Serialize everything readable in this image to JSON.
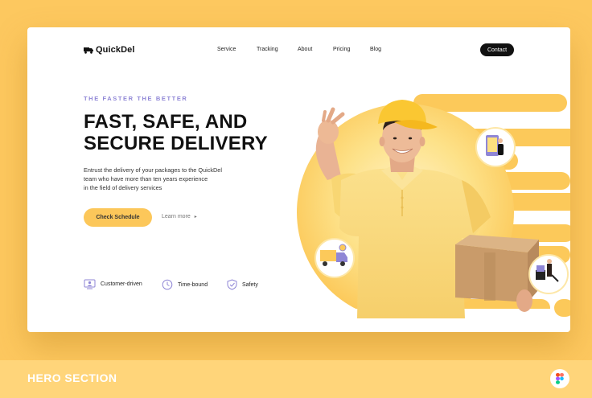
{
  "brand": {
    "name": "QuickDel"
  },
  "nav": {
    "items": [
      {
        "label": "Service"
      },
      {
        "label": "Tracking"
      },
      {
        "label": "About"
      },
      {
        "label": "Pricing"
      },
      {
        "label": "Blog"
      }
    ],
    "contact_label": "Contact"
  },
  "hero": {
    "eyebrow": "THE FASTER THE BETTER",
    "headline_line1": "FAST, SAFE, AND",
    "headline_line2": "SECURE DELIVERY",
    "desc_line1": "Entrust the delivery of your packages to the QuickDel",
    "desc_line2": "team who have more than ten years experience",
    "desc_line3": "in the field of delivery services",
    "cta_label": "Check Schedule",
    "learn_label": "Learn more"
  },
  "features": [
    {
      "label": "Customer-driven",
      "icon": "user-screen-icon"
    },
    {
      "label": "Time-bound",
      "icon": "clock-icon"
    },
    {
      "label": "Safety",
      "icon": "shield-icon"
    }
  ],
  "footer": {
    "title": "HERO SECTION"
  },
  "colors": {
    "background": "#fdc85f",
    "accent": "#fcc75a",
    "eyebrow": "#8f86d6",
    "dark": "#111111"
  }
}
